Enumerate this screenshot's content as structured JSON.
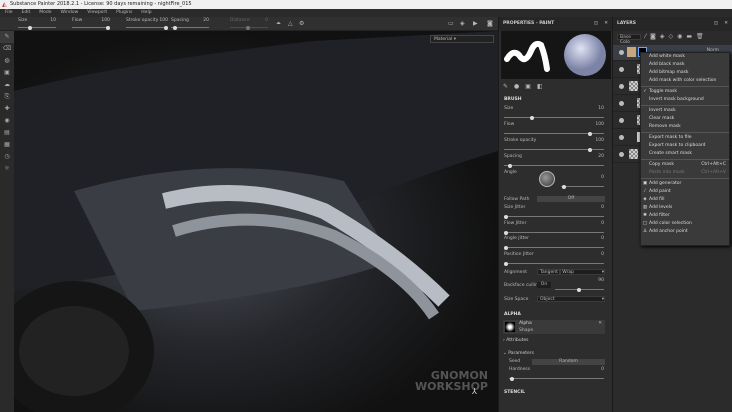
{
  "title": "Substance Painter 2018.2.1 - License: 90 days remaining - nightFire_015",
  "menu": [
    "File",
    "Edit",
    "Mode",
    "Window",
    "Viewport",
    "Plugins",
    "Help"
  ],
  "toolbar": {
    "size_label": "Size",
    "size": "10",
    "size_frac": 0.3,
    "flow_label": "Flow",
    "flow": "100",
    "flow_frac": 1,
    "opacity_label": "Stroke opacity",
    "opacity": "100",
    "opacity_frac": 1,
    "spacing_label": "Spacing",
    "spacing": "20",
    "spacing_frac": 0.1,
    "distance_label": "Distance",
    "distance": "0"
  },
  "viewport": {
    "material_select": "Material"
  },
  "properties": {
    "title": "PROPERTIES - PAINT",
    "brush_header": "BRUSH",
    "rows": [
      {
        "label": "Size",
        "value": "10",
        "frac": 0.3
      },
      {
        "label": "Flow",
        "value": "100",
        "frac": 1
      },
      {
        "label": "Stroke opacity",
        "value": "100",
        "frac": 1
      },
      {
        "label": "Spacing",
        "value": "20",
        "frac": 0.1
      }
    ],
    "angle_label": "Angle",
    "angle": "0",
    "follow_path_label": "Follow Path",
    "follow_path": "Off",
    "jitters": [
      {
        "label": "Size Jitter",
        "value": "0"
      },
      {
        "label": "Flow Jitter",
        "value": "0"
      },
      {
        "label": "Angle Jitter",
        "value": "0"
      },
      {
        "label": "Position Jitter",
        "value": "0"
      }
    ],
    "alignment_label": "Alignment",
    "alignment": "Tangent | Wrap",
    "backface_label": "Backface culling",
    "backface": "On",
    "backface_value": "90",
    "size_space_label": "Size Space",
    "size_space": "Object",
    "alpha_header": "ALPHA",
    "alpha_name": "Alpha",
    "alpha_type": "Shape",
    "attributes": "Attributes",
    "parameters": "Parameters",
    "seed_label": "Seed",
    "seed": "Random",
    "hardness_label": "Hardness",
    "hardness": "0",
    "stencil_header": "STENCIL"
  },
  "layers": {
    "title": "LAYERS",
    "channel": "Base Colo",
    "blend": "Norm"
  },
  "context_menu": {
    "items": [
      {
        "label": "Add white mask"
      },
      {
        "label": "Add black mask"
      },
      {
        "label": "Add bitmap mask"
      },
      {
        "label": "Add mask with color selection"
      },
      {
        "sep": true
      },
      {
        "label": "Toggle mask",
        "check": true
      },
      {
        "label": "Invert mask background"
      },
      {
        "sep": true
      },
      {
        "label": "Invert mask"
      },
      {
        "label": "Clear mask"
      },
      {
        "label": "Remove mask"
      },
      {
        "sep": true
      },
      {
        "label": "Export mask to file"
      },
      {
        "label": "Export mask to clipboard"
      },
      {
        "label": "Create smart mask"
      },
      {
        "sep": true
      },
      {
        "label": "Copy mask",
        "shortcut": "Ctrl+Alt+C"
      },
      {
        "label": "Paste into mask",
        "shortcut": "Ctrl+Alt+V",
        "disabled": true
      },
      {
        "sep": true
      },
      {
        "label": "Add generator",
        "icon": "▣"
      },
      {
        "label": "Add paint",
        "icon": "⁄"
      },
      {
        "label": "Add fill",
        "icon": "◈"
      },
      {
        "label": "Add levels",
        "icon": "▥"
      },
      {
        "label": "Add filter",
        "icon": "✱"
      },
      {
        "label": "Add color selection",
        "icon": "□"
      },
      {
        "label": "Add anchor point",
        "icon": "⚓"
      }
    ]
  },
  "watermark": "GNOMON WORKSHOP"
}
